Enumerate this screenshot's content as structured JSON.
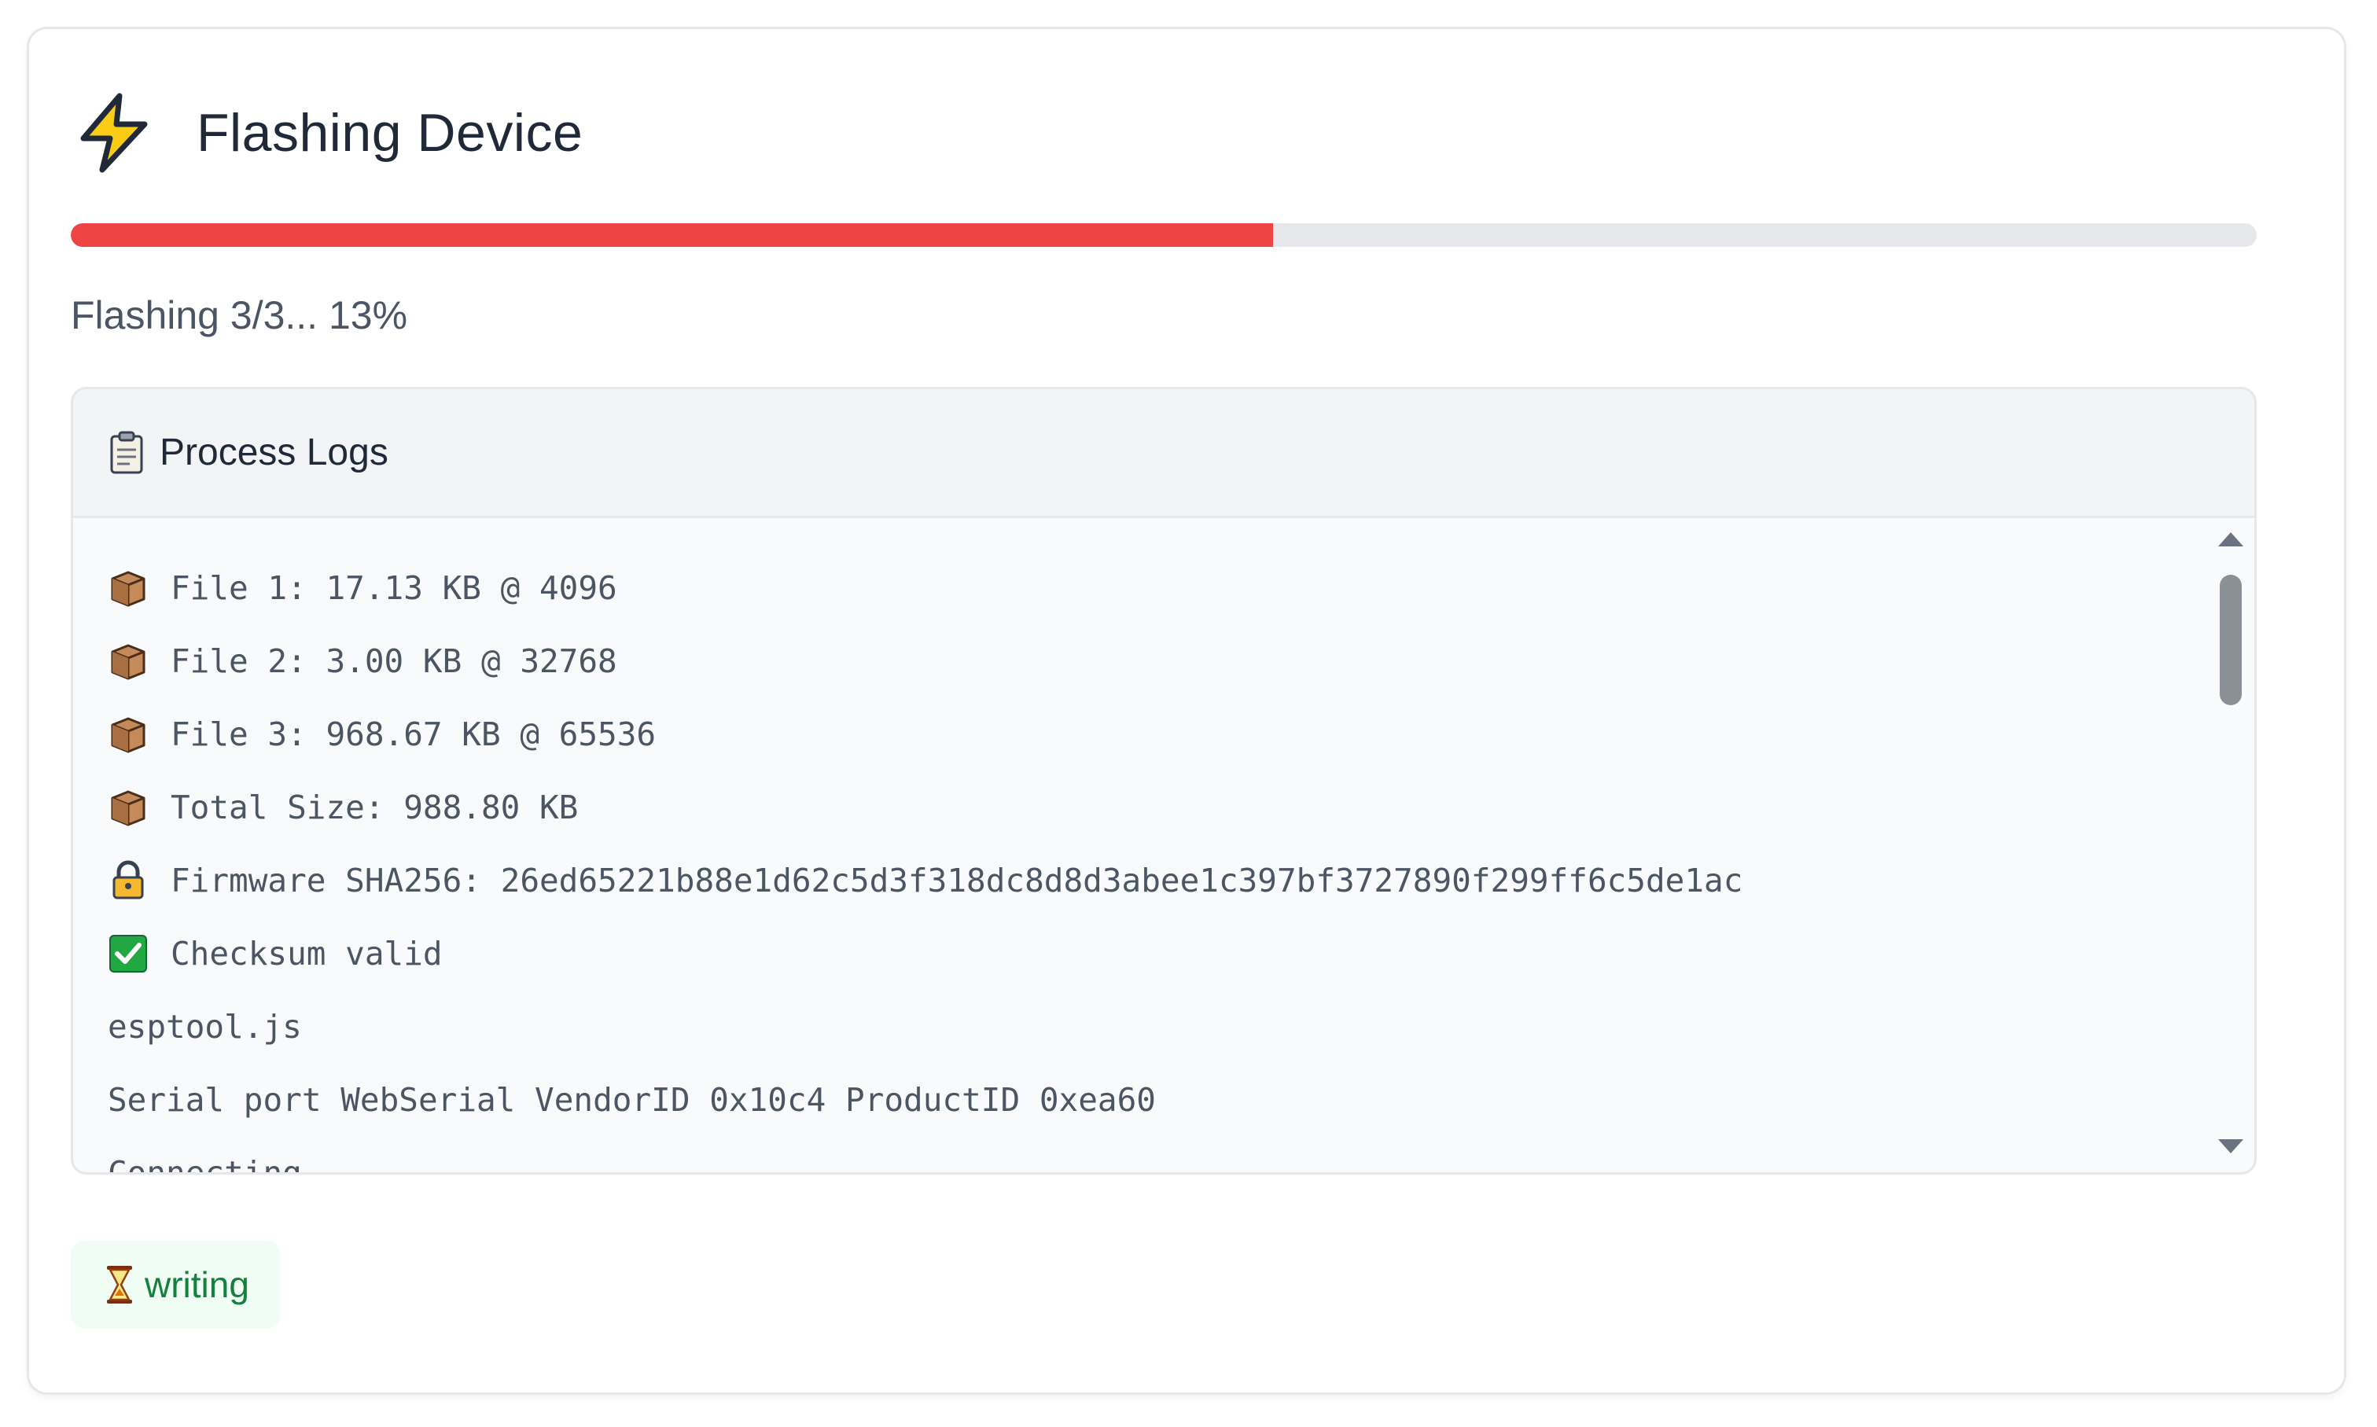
{
  "header": {
    "title": "Flashing Device",
    "icon": "lightning-bolt-icon"
  },
  "progress": {
    "fraction": 0.55,
    "text": "Flashing 3/3... 13%",
    "fill_color": "#ef4444",
    "track_color": "#e5e7eb"
  },
  "logs": {
    "title": "Process Logs",
    "icon": "clipboard-icon",
    "lines": [
      {
        "icon": "package-icon",
        "text": "File 1: 17.13 KB @ 4096"
      },
      {
        "icon": "package-icon",
        "text": "File 2: 3.00 KB @ 32768"
      },
      {
        "icon": "package-icon",
        "text": "File 3: 968.67 KB @ 65536"
      },
      {
        "icon": "package-icon",
        "text": "Total Size: 988.80 KB"
      },
      {
        "icon": "lock-icon",
        "text": "Firmware SHA256: 26ed65221b88e1d62c5d3f318dc8d8d3abee1c397bf3727890f299ff6c5de1ac"
      },
      {
        "icon": "check-icon",
        "text": "Checksum valid"
      },
      {
        "icon": "",
        "text": "esptool.js"
      },
      {
        "icon": "",
        "text": "Serial port WebSerial VendorID 0x10c4 ProductID 0xea60"
      },
      {
        "icon": "",
        "text": "Connecting..."
      }
    ]
  },
  "status": {
    "icon": "hourglass-icon",
    "text": "writing",
    "color": "#15803d"
  }
}
